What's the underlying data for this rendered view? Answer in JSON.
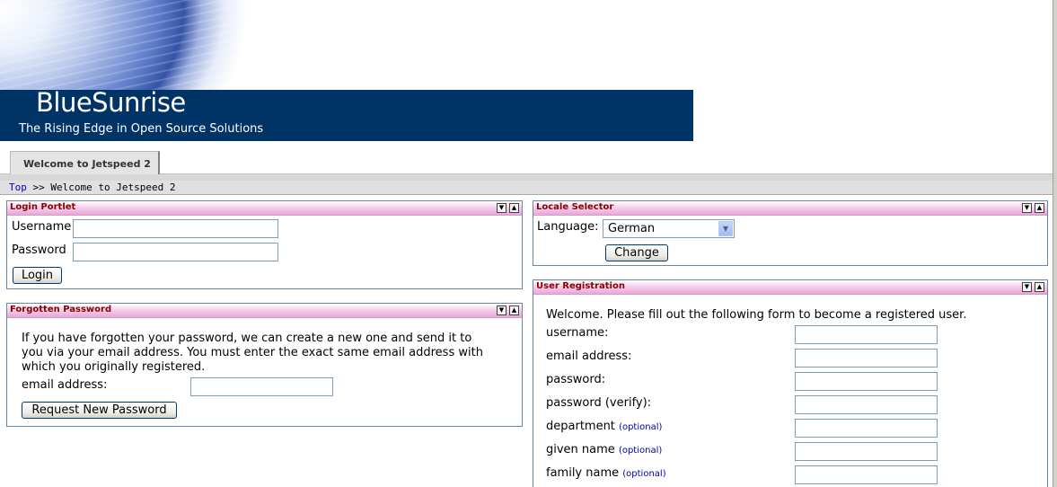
{
  "brand": {
    "title": "BlueSunrise",
    "tagline": "The Rising Edge in Open Source Solutions"
  },
  "tabs": [
    {
      "label": "Welcome to Jetspeed 2"
    }
  ],
  "breadcrumb": {
    "root": "Top",
    "separator": ">>",
    "current": "Welcome to Jetspeed 2"
  },
  "portlet_controls": {
    "minimize_icon": "▼",
    "maximize_icon": "▲"
  },
  "login": {
    "title": "Login Portlet",
    "username_label": "Username",
    "username_value": "",
    "password_label": "Password",
    "password_value": "",
    "login_button": "Login"
  },
  "forgotten_password": {
    "title": "Forgotten Password",
    "line1": "If you have forgotten your password, we can create a new one and send it to",
    "line2": "you via your email address. You must enter the exact same email address with",
    "line3": "which you originally registered.",
    "email_label": "email address:",
    "email_value": "",
    "request_button": "Request New Password"
  },
  "locale_selector": {
    "title": "Locale Selector",
    "language_label": "Language:",
    "selected_language": "German",
    "change_button": "Change"
  },
  "user_registration": {
    "title": "User Registration",
    "intro": "Welcome. Please fill out the following form to become a registered user.",
    "optional_tag": "(optional)",
    "fields": [
      {
        "label": "username:",
        "value": ""
      },
      {
        "label": "email address:",
        "value": ""
      },
      {
        "label": "password:",
        "value": ""
      },
      {
        "label": "password (verify):",
        "value": ""
      },
      {
        "label": "department",
        "value": ""
      },
      {
        "label": "given name",
        "value": ""
      },
      {
        "label": "family name",
        "value": ""
      }
    ]
  }
}
